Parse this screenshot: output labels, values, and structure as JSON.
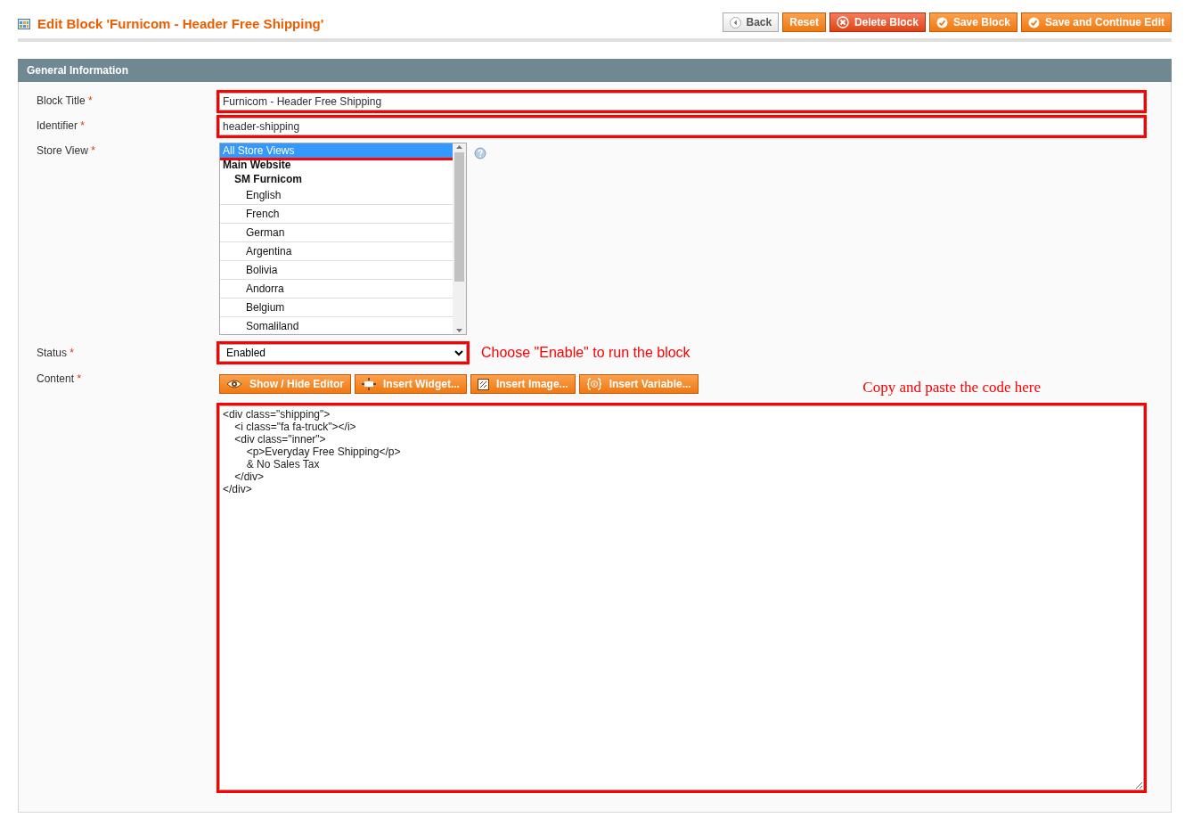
{
  "page_title": "Edit Block 'Furnicom - Header Free Shipping'",
  "header_buttons": [
    {
      "label": "Back",
      "kind": "plain"
    },
    {
      "label": "Reset",
      "kind": "orange"
    },
    {
      "label": "Delete Block",
      "kind": "red"
    },
    {
      "label": "Save Block",
      "kind": "orange"
    },
    {
      "label": "Save and Continue Edit",
      "kind": "orange"
    }
  ],
  "section_title": "General Information",
  "fields": [
    {
      "kind": "text",
      "label": "Block Title",
      "required_mark": "*",
      "value": "Furnicom - Header Free Shipping",
      "highlighted": true
    },
    {
      "kind": "text",
      "label": "Identifier",
      "required_mark": "*",
      "value": "header-shipping",
      "highlighted": true
    },
    {
      "kind": "multiselect",
      "label": "Store View",
      "required_mark": "*",
      "options": [
        {
          "label": "All Store Views",
          "kind": "option",
          "selected": true,
          "highlighted": true
        },
        {
          "label": "Main Website",
          "kind": "website",
          "selected": false,
          "highlighted": false
        },
        {
          "label": "SM Furnicom",
          "kind": "store",
          "selected": false,
          "highlighted": false
        },
        {
          "label": "English",
          "kind": "view",
          "selected": false,
          "highlighted": false
        },
        {
          "label": "French",
          "kind": "view",
          "selected": false,
          "highlighted": false
        },
        {
          "label": "German",
          "kind": "view",
          "selected": false,
          "highlighted": false
        },
        {
          "label": "Argentina",
          "kind": "view",
          "selected": false,
          "highlighted": false
        },
        {
          "label": "Bolivia",
          "kind": "view",
          "selected": false,
          "highlighted": false
        },
        {
          "label": "Andorra",
          "kind": "view",
          "selected": false,
          "highlighted": false
        },
        {
          "label": "Belgium",
          "kind": "view",
          "selected": false,
          "highlighted": false
        },
        {
          "label": "Somaliland",
          "kind": "view",
          "selected": false,
          "highlighted": false
        }
      ]
    },
    {
      "kind": "select",
      "label": "Status",
      "required_mark": "*",
      "value": "Enabled",
      "highlighted": true,
      "note": "Choose \"Enable\" to run the block"
    },
    {
      "kind": "editor",
      "label": "Content",
      "required_mark": "*",
      "highlighted": true,
      "note": "Copy and paste the code here",
      "buttons": [
        {
          "label": "Show / Hide Editor"
        },
        {
          "label": "Insert Widget..."
        },
        {
          "label": "Insert Image..."
        },
        {
          "label": "Insert Variable..."
        }
      ],
      "value": "<div class=\"shipping\">\n\t<i class=\"fa fa-truck\"></i>\n\t<div class=\"inner\">\n\t\t<p>Everyday Free Shipping</p>\n\t\t& No Sales Tax\n\t</div>\n</div>"
    }
  ]
}
